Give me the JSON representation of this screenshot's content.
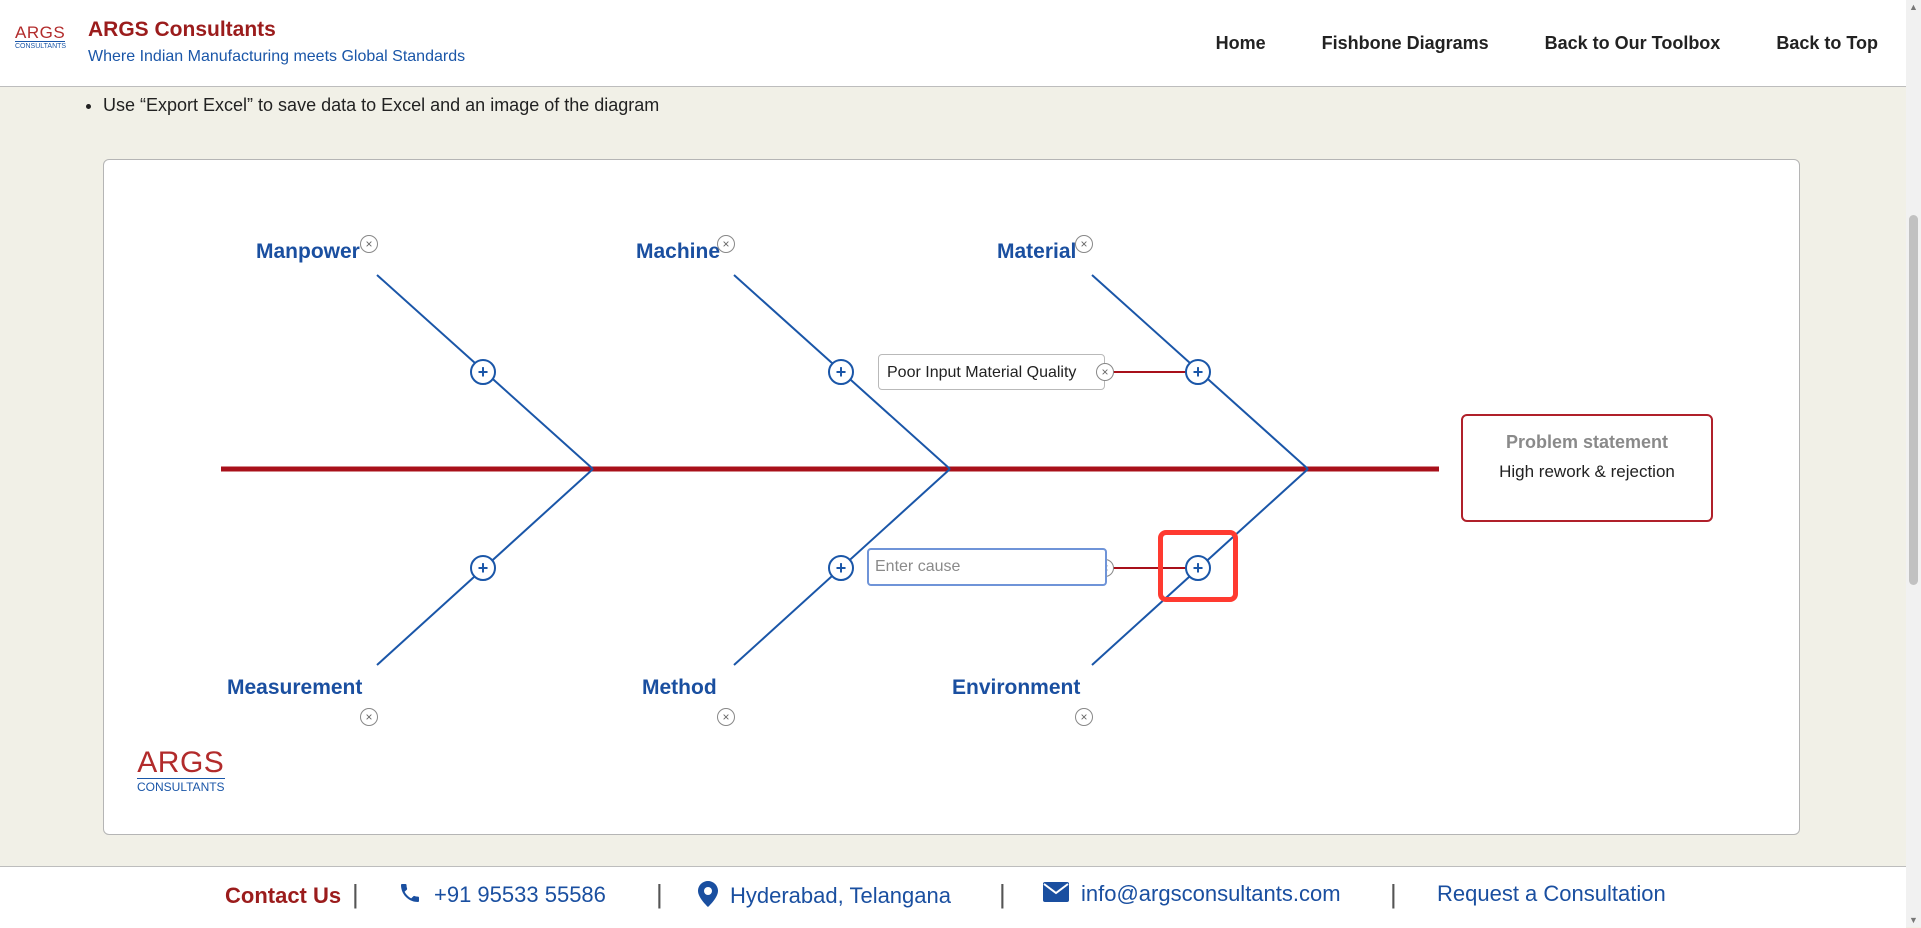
{
  "header": {
    "logo_line1": "ARGS",
    "logo_line2": "CONSULTANTS",
    "brand_title": "ARGS Consultants",
    "brand_tagline": "Where Indian Manufacturing meets Global Standards",
    "nav": [
      "Home",
      "Fishbone Diagrams",
      "Back to Our Toolbox",
      "Back to Top"
    ]
  },
  "instructions": {
    "bullet": "Use “Export Excel” to save data to Excel and an image of the diagram"
  },
  "diagram": {
    "categories": {
      "top": [
        "Manpower",
        "Machine",
        "Material"
      ],
      "bottom": [
        "Measurement",
        "Method",
        "Environment"
      ]
    },
    "add_cause_symbol": "+",
    "remove_symbol": "×",
    "causes": {
      "material": "Poor Input Material Quality"
    },
    "new_cause_placeholder": "Enter cause",
    "problem_title": "Problem statement",
    "problem_text": "High rework & rejection",
    "watermark_line1": "ARGS",
    "watermark_line2": "CONSULTANTS",
    "colors": {
      "spine": "#a8101a",
      "bones": "#1a56a8",
      "accent": "#9b1c1c"
    }
  },
  "footer": {
    "contact_label": "Contact Us",
    "separator": "|",
    "phone": "+91 95533 55586",
    "location": "Hyderabad, Telangana",
    "email": "info@argsconsultants.com",
    "cta": "Request a Consultation",
    "icons": [
      "phone-icon",
      "location-pin-icon",
      "email-icon"
    ]
  }
}
